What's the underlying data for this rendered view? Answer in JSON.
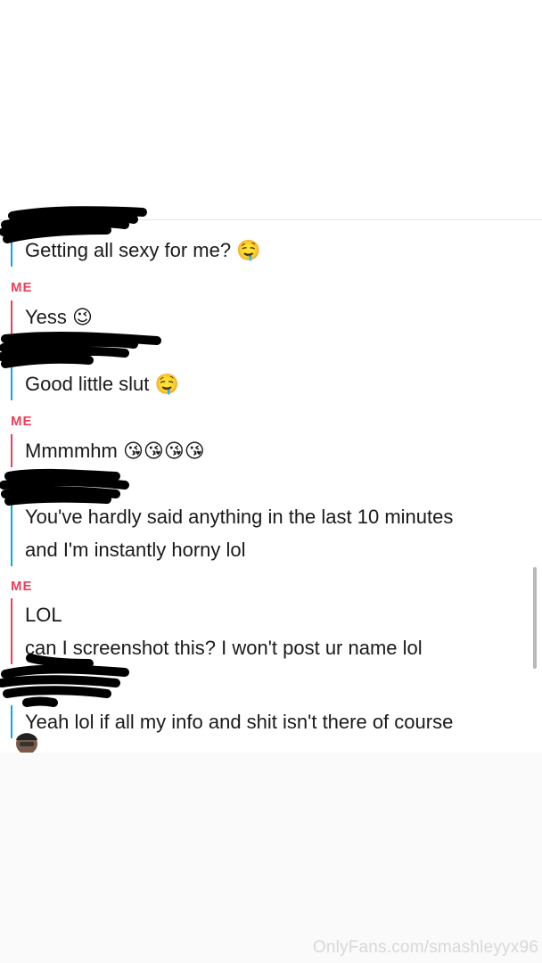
{
  "chat": {
    "messages": [
      {
        "sender": "",
        "text": "Getting all sexy for me? 🤤"
      },
      {
        "sender": "ME",
        "text": "Yess 😉"
      },
      {
        "sender": "",
        "text": "Good little slut 🤤"
      },
      {
        "sender": "ME",
        "text": "Mmmmhm 😘😘😘😘"
      },
      {
        "sender": "",
        "lines": [
          "You've hardly said anything in the last 10 minutes",
          "and I'm instantly horny lol"
        ]
      },
      {
        "sender": "ME",
        "lines": [
          "LOL",
          "can I screenshot this? I won't post ur name lol"
        ]
      },
      {
        "sender": "",
        "text": "Yeah lol if all my info and shit isn't there of course"
      }
    ]
  },
  "watermark": "OnlyFans.com/smashleyyx96",
  "colors": {
    "me": "#f23c57",
    "them": "#0ea5f0"
  },
  "icons": [
    "avatar-icon"
  ]
}
